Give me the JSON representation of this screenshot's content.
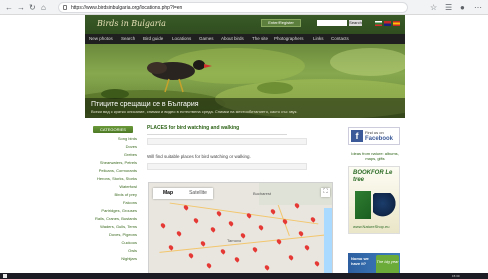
{
  "browser": {
    "url": "https://www.birdsinbulgaria.org/locations.php?l=en",
    "back_icon": "arrow-left-icon",
    "forward_icon": "arrow-right-icon",
    "reload_icon": "reload-icon",
    "home_icon": "home-icon"
  },
  "header": {
    "logo_text": "Birds in Bulgaria",
    "register_label": "Enter/Register",
    "search_label": "Search"
  },
  "nav": {
    "items": [
      "New photos",
      "Search",
      "Bird guide",
      "Locations",
      "Games",
      "About birds",
      "The site",
      "Photographers",
      "Links",
      "Contacts"
    ]
  },
  "banner": {
    "title": "Птиците срещащи се в България",
    "subtitle": "Всеки вид с кратко описание, снимки и видео в естествена среда. Снимки на местообитанието, както със звук."
  },
  "sidebar": {
    "heading": "CATEGORIES",
    "items": [
      "Song birds",
      "Doves",
      "Grebes",
      "Shearwaters, Petrels",
      "Pelicans, Cormorants",
      "Herons, Storks, Storks",
      "Waterfowl",
      "Birds of prey",
      "Falcons",
      "Partridges, Grouses",
      "Rails, Cranes, Bustards",
      "Waders, Gulls, Terns",
      "Doves, Pigeons",
      "Cuckoos",
      "Owls",
      "Nightjars"
    ]
  },
  "main": {
    "title": "PLACES for bird watching and walking",
    "instruction": "Will find suitable places for bird watching or walking."
  },
  "map": {
    "tab_map": "Map",
    "tab_satellite": "Satellite",
    "fullscreen_icon": "fullscreen-icon",
    "cities": [
      "Bucharest",
      "Tarnovo"
    ]
  },
  "ads": {
    "fb_find": "Find us on",
    "fb_name": "Facebook",
    "ideas": "Ideas from nature: albums, maps, gifts",
    "book_title": "BOOKFOR Le tree",
    "book_site": "www.NatureShop.eu",
    "promo_text": "Nomo we have it?",
    "promo_badge": "The big year"
  },
  "taskbar": {
    "time": "15:30"
  },
  "colors": {
    "header_green": "#3a5a28",
    "nav_dark": "#1f1f1f",
    "link_green": "#3b6a1f",
    "pin_red": "#e53935",
    "facebook_blue": "#3b5998"
  }
}
